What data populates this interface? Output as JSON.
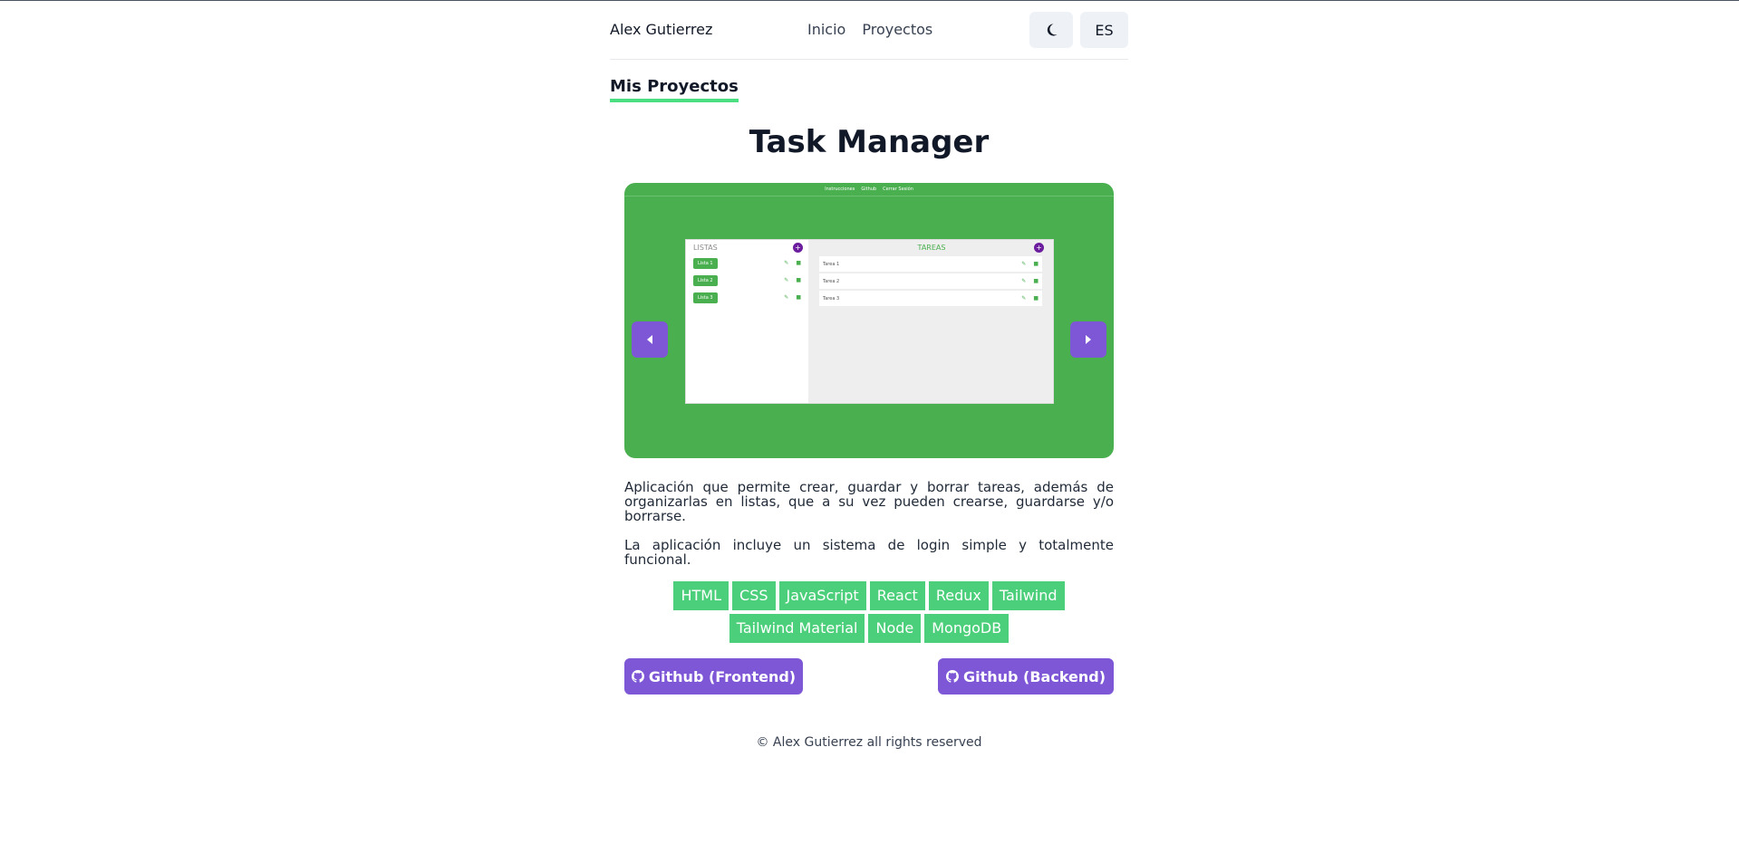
{
  "header": {
    "brand": "Alex Gutierrez",
    "nav": [
      "Inicio",
      "Proyectos"
    ],
    "theme_icon": "moon-icon",
    "language": "ES"
  },
  "section": {
    "title": "Mis Proyectos"
  },
  "project": {
    "title": "Task Manager",
    "preview": {
      "nav": [
        "Instrucciones",
        "Github",
        "Cerrar Sesión"
      ],
      "lists_header": "LISTAS",
      "tasks_header": "TAREAS",
      "lists": [
        "Lista 1",
        "Lista 2",
        "Lista 3"
      ],
      "tasks": [
        "Tarea 1",
        "Tarea 2",
        "Tarea 3"
      ]
    },
    "description": [
      "Aplicación que permite crear, guardar y borrar tareas, además de organizarlas en listas, que a su vez pueden crearse, guardarse y/o borrarse.",
      "La aplicación incluye un sistema de login simple y totalmente funcional."
    ],
    "tags": [
      "HTML",
      "CSS",
      "JavaScript",
      "React",
      "Redux",
      "Tailwind",
      "Tailwind Material",
      "Node",
      "MongoDB"
    ],
    "buttons": {
      "frontend": "Github (Frontend)",
      "backend": "Github (Backend)"
    }
  },
  "footer": {
    "text": "© Alex Gutierrez all rights reserved"
  },
  "colors": {
    "accent": "#7e57d6",
    "tag": "#4ccf7a",
    "carousel_bg": "#4aaf4f",
    "underline": "#4ade80"
  }
}
